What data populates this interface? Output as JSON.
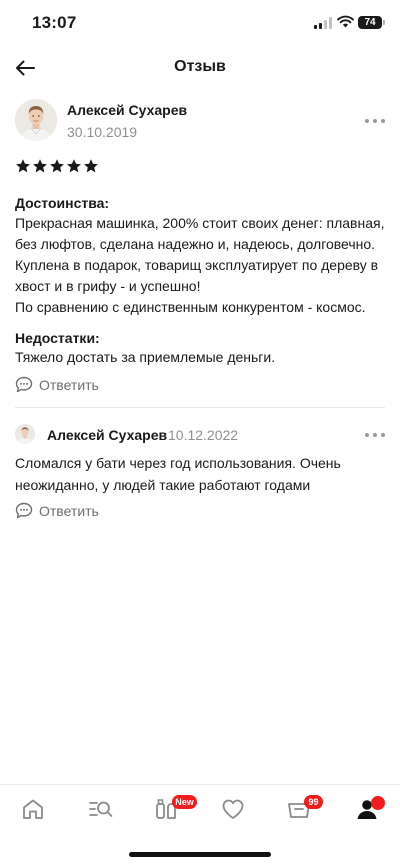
{
  "status_bar": {
    "time": "13:07",
    "battery": "74"
  },
  "header": {
    "title": "Отзыв"
  },
  "review": {
    "author": "Алексей Сухарев",
    "date": "30.10.2019",
    "rating": 5,
    "advantages_title": "Достоинства:",
    "advantages_lines": [
      "Прекрасная машинка, 200% стоит своих денег: плавная,",
      "без люфтов, сделана надежно и, надеюсь, долговечно.",
      "Куплена в подарок, товарищ эксплуатирует по дереву в",
      "хвост и в грифу - и успешно!",
      "По сравнению с единственным конкурентом - космос."
    ],
    "disadvantages_title": "Недостатки:",
    "disadvantages_text": "Тяжело достать за приемлемые деньги.",
    "reply_label": "Ответить"
  },
  "comment": {
    "author": "Алексей Сухарев",
    "date": "10.12.2022",
    "lines": [
      "Сломался у бати через год использования. Очень",
      "неожиданно, у людей такие работают годами"
    ],
    "reply_label": "Ответить"
  },
  "bottom_nav": {
    "items": [
      {
        "icon": "home-icon"
      },
      {
        "icon": "catalog-search-icon"
      },
      {
        "icon": "products-icon",
        "badge": "New"
      },
      {
        "icon": "favorites-heart-icon"
      },
      {
        "icon": "cart-icon",
        "badge": "99"
      },
      {
        "icon": "profile-icon",
        "dot": true
      }
    ]
  },
  "colors": {
    "badge": "#f21c1c",
    "text": "#1a1a1a",
    "muted": "#8f8f8f"
  }
}
